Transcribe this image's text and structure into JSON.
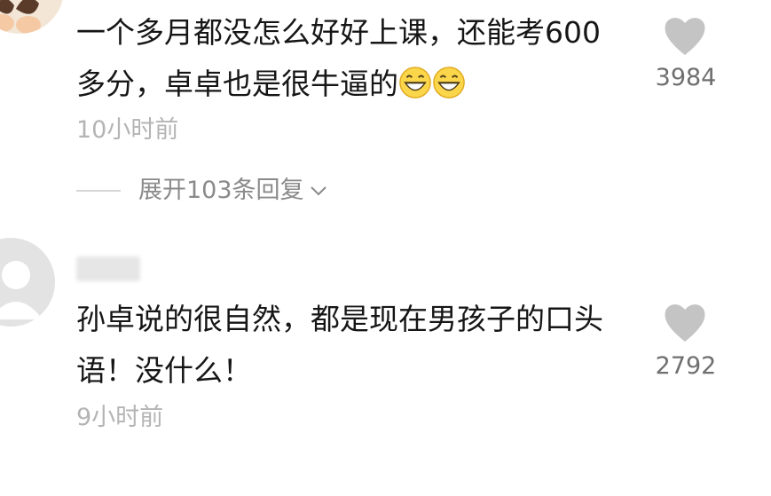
{
  "comments": [
    {
      "text": "一个多月都没怎么好好上课，还能考600多分，卓卓也是很牛逼的",
      "emojis": [
        "grinning-face-icon",
        "grinning-face-icon"
      ],
      "time": "10小时前",
      "likes": "3984",
      "expand_replies": "展开103条回复"
    },
    {
      "text": "孙卓说的很自然，都是现在男孩子的口头语！没什么！",
      "time": "9小时前",
      "likes": "2792"
    }
  ],
  "colors": {
    "text": "#161616",
    "time": "#b4b4b4",
    "heart": "#c4c4c4",
    "count": "#6f6f6f",
    "emoji_face": "#fbd64a"
  }
}
